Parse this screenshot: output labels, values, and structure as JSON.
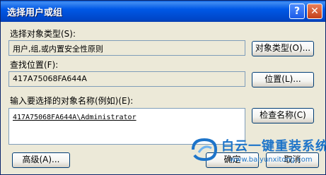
{
  "window": {
    "title": "选择用户或组"
  },
  "titlebar": {
    "help_label": "?",
    "close_label": "✕"
  },
  "object_type": {
    "label": "选择对象类型(S):",
    "value": "用户,组,或内置安全性原则",
    "button_label": "对象类型(O)..."
  },
  "location": {
    "label": "查找位置(F):",
    "value": "417A75068FA644A",
    "button_label": "位置(L)..."
  },
  "names": {
    "label": "输入要选择的对象名称(例如)(E):",
    "value": "417A75068FA644A\\Administrator",
    "check_button_label": "检查名称(C)"
  },
  "footer": {
    "advanced_label": "高级(A)...",
    "ok_label": "确定",
    "cancel_label": "取消"
  },
  "watermark": {
    "title": "白云一键重装系统",
    "url": "www.baiyunxitong.com"
  },
  "colors": {
    "titlebar": "#0058e6",
    "dialog_bg": "#ece9d8",
    "watermark": "#1d74c9"
  }
}
